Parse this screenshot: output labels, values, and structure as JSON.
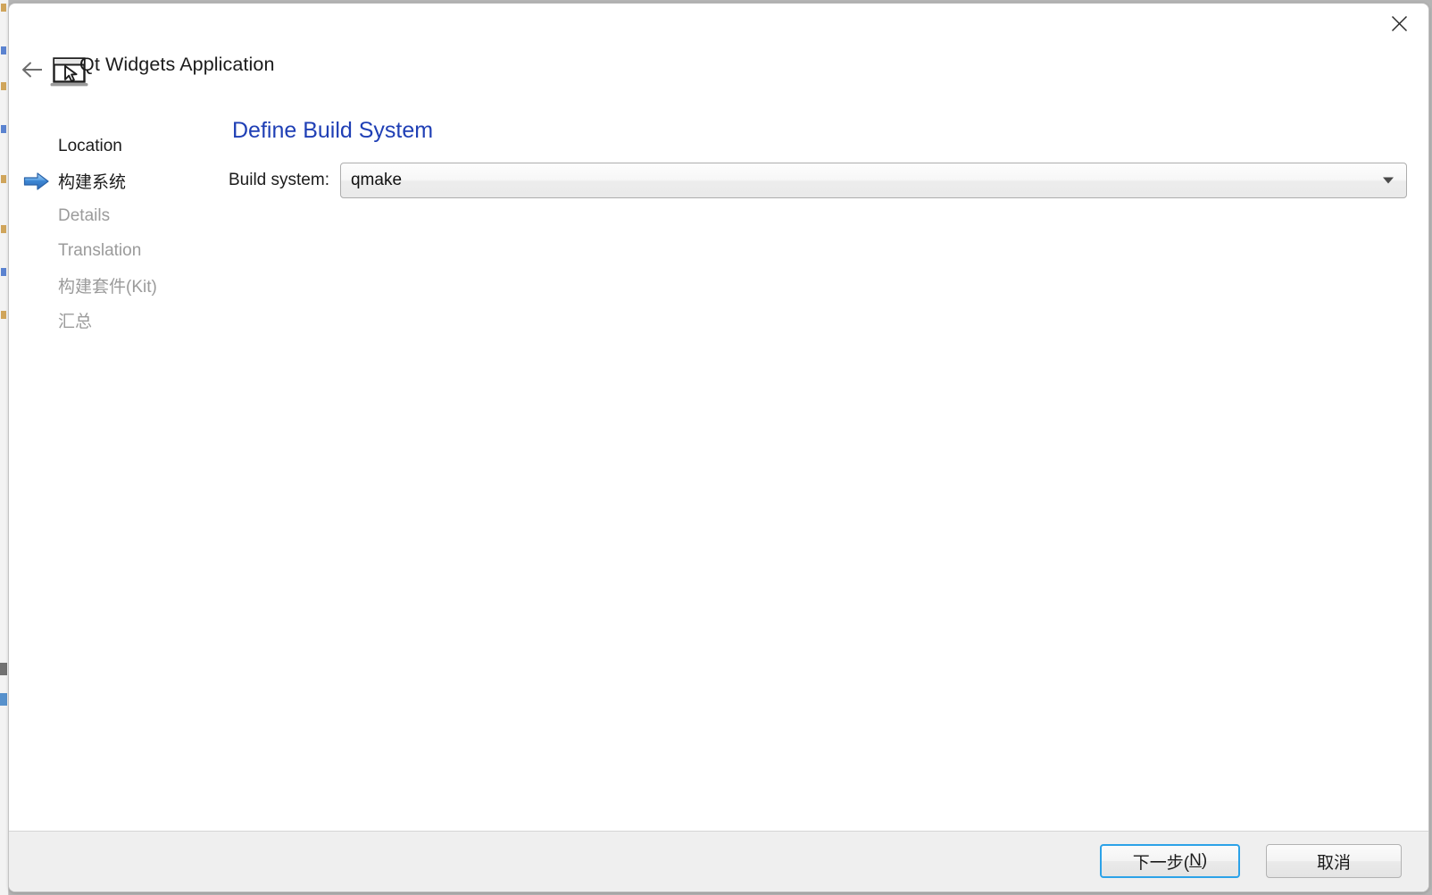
{
  "window": {
    "title": "Qt Widgets Application",
    "icon": "application-window-cursor-icon",
    "close_label": "✕",
    "back_label": "←"
  },
  "steps": [
    {
      "label": "Location",
      "state": "done",
      "marker": ""
    },
    {
      "label": "构建系统",
      "state": "current",
      "marker": "blue-arrow-icon"
    },
    {
      "label": "Details",
      "state": "disabled",
      "marker": ""
    },
    {
      "label": "Translation",
      "state": "disabled",
      "marker": ""
    },
    {
      "label": "构建套件(Kit)",
      "state": "disabled",
      "marker": ""
    },
    {
      "label": "汇总",
      "state": "disabled",
      "marker": ""
    }
  ],
  "main": {
    "heading": "Define Build System",
    "build_system": {
      "label": "Build system:",
      "value": "qmake"
    }
  },
  "footer": {
    "next": {
      "text": "下一步(",
      "accel": "N",
      "text_end": ")",
      "default": true
    },
    "cancel": {
      "text": "取消"
    }
  },
  "colors": {
    "heading_blue": "#1f3fb5",
    "default_button_border": "#2ca2e8",
    "disabled_text": "#9b9b9b",
    "footer_bg": "#efefef",
    "window_bg": "#ffffff"
  }
}
